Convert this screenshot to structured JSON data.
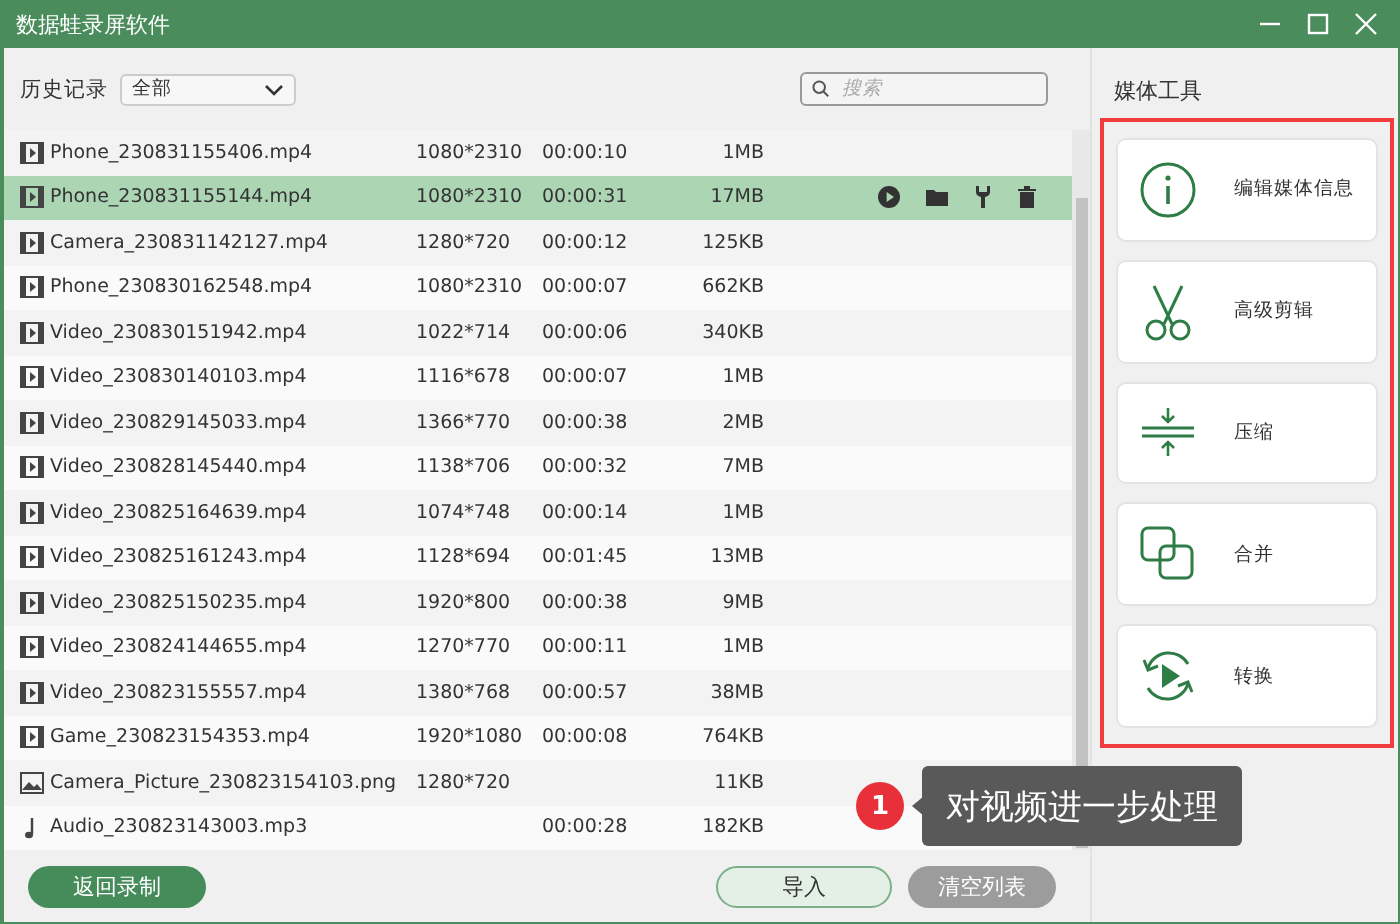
{
  "window": {
    "title": "数据蛙录屏软件"
  },
  "toolbar": {
    "history_label": "历史记录",
    "filter": "全部",
    "search": {
      "placeholder": "搜索"
    }
  },
  "rows": [
    {
      "kind": "video",
      "name": "Phone_230831155406.mp4",
      "resolution": "1080*2310",
      "duration": "00:00:10",
      "size": "1MB",
      "selected": false
    },
    {
      "kind": "video",
      "name": "Phone_230831155144.mp4",
      "resolution": "1080*2310",
      "duration": "00:00:31",
      "size": "17MB",
      "selected": true
    },
    {
      "kind": "video",
      "name": "Camera_230831142127.mp4",
      "resolution": "1280*720",
      "duration": "00:00:12",
      "size": "125KB",
      "selected": false
    },
    {
      "kind": "video",
      "name": "Phone_230830162548.mp4",
      "resolution": "1080*2310",
      "duration": "00:00:07",
      "size": "662KB",
      "selected": false
    },
    {
      "kind": "video",
      "name": "Video_230830151942.mp4",
      "resolution": "1022*714",
      "duration": "00:00:06",
      "size": "340KB",
      "selected": false
    },
    {
      "kind": "video",
      "name": "Video_230830140103.mp4",
      "resolution": "1116*678",
      "duration": "00:00:07",
      "size": "1MB",
      "selected": false
    },
    {
      "kind": "video",
      "name": "Video_230829145033.mp4",
      "resolution": "1366*770",
      "duration": "00:00:38",
      "size": "2MB",
      "selected": false
    },
    {
      "kind": "video",
      "name": "Video_230828145440.mp4",
      "resolution": "1138*706",
      "duration": "00:00:32",
      "size": "7MB",
      "selected": false
    },
    {
      "kind": "video",
      "name": "Video_230825164639.mp4",
      "resolution": "1074*748",
      "duration": "00:00:14",
      "size": "1MB",
      "selected": false
    },
    {
      "kind": "video",
      "name": "Video_230825161243.mp4",
      "resolution": "1128*694",
      "duration": "00:01:45",
      "size": "13MB",
      "selected": false
    },
    {
      "kind": "video",
      "name": "Video_230825150235.mp4",
      "resolution": "1920*800",
      "duration": "00:00:38",
      "size": "9MB",
      "selected": false
    },
    {
      "kind": "video",
      "name": "Video_230824144655.mp4",
      "resolution": "1270*770",
      "duration": "00:00:11",
      "size": "1MB",
      "selected": false
    },
    {
      "kind": "video",
      "name": "Video_230823155557.mp4",
      "resolution": "1380*768",
      "duration": "00:00:57",
      "size": "38MB",
      "selected": false
    },
    {
      "kind": "video",
      "name": "Game_230823154353.mp4",
      "resolution": "1920*1080",
      "duration": "00:00:08",
      "size": "764KB",
      "selected": false
    },
    {
      "kind": "image",
      "name": "Camera_Picture_230823154103.png",
      "resolution": "1280*720",
      "size": "11KB",
      "selected": false
    },
    {
      "kind": "audio",
      "name": "Audio_230823143003.mp3",
      "duration": "00:00:28",
      "size": "182KB",
      "selected": false
    }
  ],
  "buttons": {
    "back": "返回录制",
    "import": "导入",
    "clear": "清空列表"
  },
  "media_tools": {
    "title": "媒体工具",
    "tools": [
      {
        "kind": "info",
        "label": "编辑媒体信息"
      },
      {
        "kind": "cut",
        "label": "高级剪辑"
      },
      {
        "kind": "compress",
        "label": "压缩"
      },
      {
        "kind": "merge",
        "label": "合并"
      },
      {
        "kind": "convert",
        "label": "转换"
      }
    ]
  },
  "annotation": {
    "number": "1",
    "text": "对视频进一步处理"
  }
}
